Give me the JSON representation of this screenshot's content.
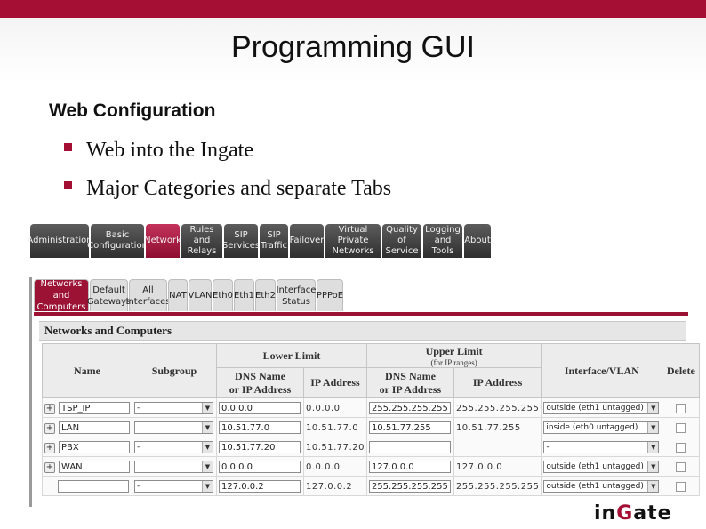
{
  "slide": {
    "title": "Programming GUI",
    "subtitle": "Web Configuration",
    "bullets": [
      "Web into the Ingate",
      "Major Categories and separate Tabs"
    ]
  },
  "main_tabs": [
    {
      "label": "Administration",
      "active": false
    },
    {
      "label": "Basic\nConfiguration",
      "active": false
    },
    {
      "label": "Network",
      "active": true
    },
    {
      "label": "Rules and\nRelays",
      "active": false
    },
    {
      "label": "SIP\nServices",
      "active": false
    },
    {
      "label": "SIP\nTraffic",
      "active": false
    },
    {
      "label": "Failover",
      "active": false
    },
    {
      "label": "Virtual Private\nNetworks",
      "active": false
    },
    {
      "label": "Quality of\nService",
      "active": false
    },
    {
      "label": "Logging\nand Tools",
      "active": false
    },
    {
      "label": "About",
      "active": false
    }
  ],
  "sub_tabs": [
    {
      "label": "Networks and\nComputers",
      "active": true
    },
    {
      "label": "Default\nGateways",
      "active": false
    },
    {
      "label": "All\nInterfaces",
      "active": false
    },
    {
      "label": "NAT",
      "active": false
    },
    {
      "label": "VLAN",
      "active": false
    },
    {
      "label": "Eth0",
      "active": false
    },
    {
      "label": "Eth1",
      "active": false
    },
    {
      "label": "Eth2",
      "active": false
    },
    {
      "label": "Interface\nStatus",
      "active": false
    },
    {
      "label": "PPPoE",
      "active": false
    }
  ],
  "section_title": "Networks and Computers",
  "table": {
    "headers": {
      "name": "Name",
      "subgroup": "Subgroup",
      "lower_limit": "Lower Limit",
      "upper_limit": "Upper Limit",
      "upper_limit_note": "(for IP ranges)",
      "dns_name": "DNS Name\nor IP Address",
      "ip_address": "IP Address",
      "interface_vlan": "Interface/VLAN",
      "delete": "Delete"
    },
    "rows": [
      {
        "name": "TSP_IP",
        "subgroup": "-",
        "lower_dns": "0.0.0.0",
        "lower_ip": "0.0.0.0",
        "upper_dns": "255.255.255.255",
        "upper_ip": "255.255.255.255",
        "interface": "outside (eth1 untagged)"
      },
      {
        "name": "LAN",
        "subgroup": "",
        "lower_dns": "10.51.77.0",
        "lower_ip": "10.51.77.0",
        "upper_dns": "10.51.77.255",
        "upper_ip": "10.51.77.255",
        "interface": "inside (eth0 untagged)"
      },
      {
        "name": "PBX",
        "subgroup": "-",
        "lower_dns": "10.51.77.20",
        "lower_ip": "10.51.77.20",
        "upper_dns": "",
        "upper_ip": "",
        "interface": "-"
      },
      {
        "name": "WAN",
        "subgroup": "",
        "lower_dns": "0.0.0.0",
        "lower_ip": "0.0.0.0",
        "upper_dns": "127.0.0.0",
        "upper_ip": "127.0.0.0",
        "interface": "outside (eth1 untagged)"
      },
      {
        "name": "",
        "subgroup": "-",
        "lower_dns": "127.0.0.2",
        "lower_ip": "127.0.0.2",
        "upper_dns": "255.255.255.255",
        "upper_ip": "255.255.255.255",
        "interface": "outside (eth1 untagged)"
      }
    ]
  },
  "logo": {
    "part1": "in",
    "part2": "G",
    "part3": "ate"
  },
  "colors": {
    "brand": "#a50f34",
    "tab_dark": "#3a3a3a",
    "active_subtab": "#9b1235"
  }
}
